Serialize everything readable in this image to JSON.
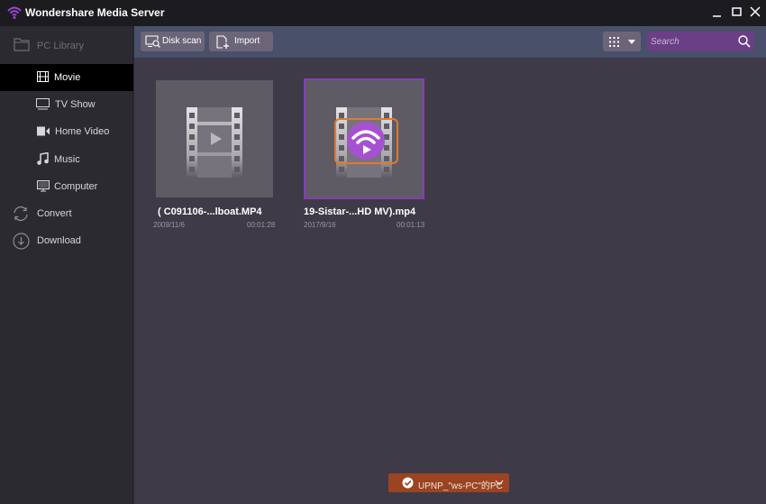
{
  "app": {
    "title": "Wondershare Media Server",
    "accent_color": "#8a3cb8"
  },
  "window_controls": {
    "minimize_icon": "minimize-icon",
    "maximize_icon": "maximize-icon",
    "close_icon": "close-icon"
  },
  "sidebar": {
    "header": {
      "label": "PC Library",
      "icon": "folder-icon"
    },
    "items": [
      {
        "label": "Movie",
        "icon": "film-icon",
        "active": true
      },
      {
        "label": "TV Show",
        "icon": "tv-icon",
        "active": false
      },
      {
        "label": "Home Video",
        "icon": "video-camera-icon",
        "active": false
      },
      {
        "label": "Music",
        "icon": "music-note-icon",
        "active": false
      },
      {
        "label": "Computer",
        "icon": "monitor-icon",
        "active": false
      }
    ],
    "sections": [
      {
        "label": "Convert",
        "icon": "convert-icon"
      },
      {
        "label": "Download",
        "icon": "download-icon"
      }
    ]
  },
  "toolbar": {
    "disk_scan_label": "Disk scan",
    "import_label": "Import",
    "view_mode_icon": "grid-view-icon",
    "search": {
      "placeholder": "Search",
      "value": ""
    }
  },
  "media": [
    {
      "title": "( C091106-...lboat.MP4",
      "date": "2009/11/6",
      "duration": "00:01:28",
      "selected": false,
      "casting": false
    },
    {
      "title": "19-Sistar-...HD MV).mp4",
      "date": "2017/9/16",
      "duration": "00:01:13",
      "selected": true,
      "casting": true
    }
  ],
  "status": {
    "device_label": "UPNP_\"ws-PC\"的PC",
    "color": "#9a4422"
  }
}
